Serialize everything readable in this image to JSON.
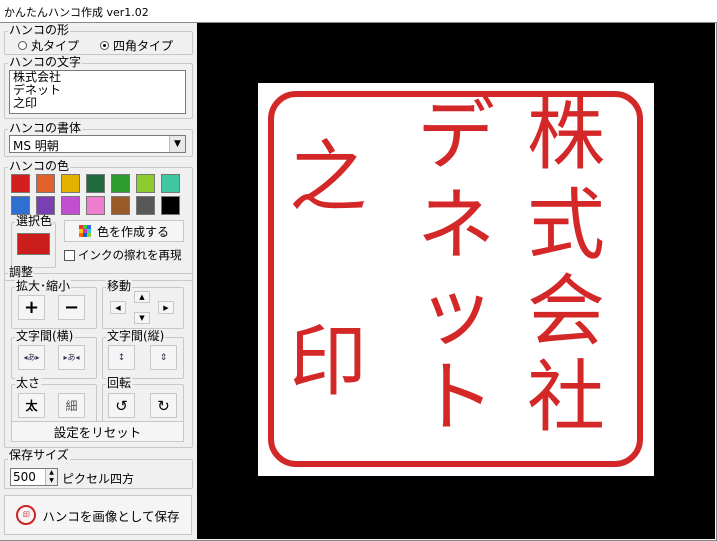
{
  "window": {
    "title": "かんたんハンコ作成 ver1.02"
  },
  "shape": {
    "label": "ハンコの形",
    "options": [
      "丸タイプ",
      "四角タイプ"
    ],
    "selected": "四角タイプ"
  },
  "text": {
    "label": "ハンコの文字",
    "lines": [
      "株式会社",
      "デネット",
      "之印"
    ]
  },
  "font": {
    "label": "ハンコの書体",
    "selected": "MS 明朝"
  },
  "color": {
    "label": "ハンコの色",
    "palette": [
      "#d21f1f",
      "#e0622a",
      "#e3b100",
      "#1f6b3e",
      "#2e9b2e",
      "#8ccc2e",
      "#3fc6a3",
      "#2f6fcf",
      "#7a3fb0",
      "#c24fd0",
      "#f07ed0",
      "#9a5a2a",
      "#585858",
      "#000000"
    ],
    "selected_label": "選択色",
    "selected_value": "#cc1d1d",
    "create_button": "色を作成する",
    "smudge_label": "インクの擦れを再現",
    "smudge_checked": false
  },
  "adjust": {
    "label": "調整",
    "zoom_label": "拡大･縮小",
    "zoom_in": "+",
    "zoom_out": "−",
    "move_label": "移動",
    "hspacing_label": "文字間(横)",
    "vspacing_label": "文字間(縦)",
    "weight_label": "太さ",
    "bold_label": "太",
    "thin_label": "細",
    "rotate_label": "回転",
    "reset_button": "設定をリセット"
  },
  "save": {
    "label": "保存サイズ",
    "size_value": "500",
    "size_unit": "ピクセル四方",
    "save_button": "ハンコを画像として保存"
  },
  "stamp": {
    "columns": [
      [
        "株",
        "式",
        "会",
        "社"
      ],
      [
        "デ",
        "ネ",
        "ッ",
        "ト"
      ],
      [
        "之",
        "印"
      ]
    ],
    "ink_color": "#d42828",
    "background": "#ffffff"
  }
}
